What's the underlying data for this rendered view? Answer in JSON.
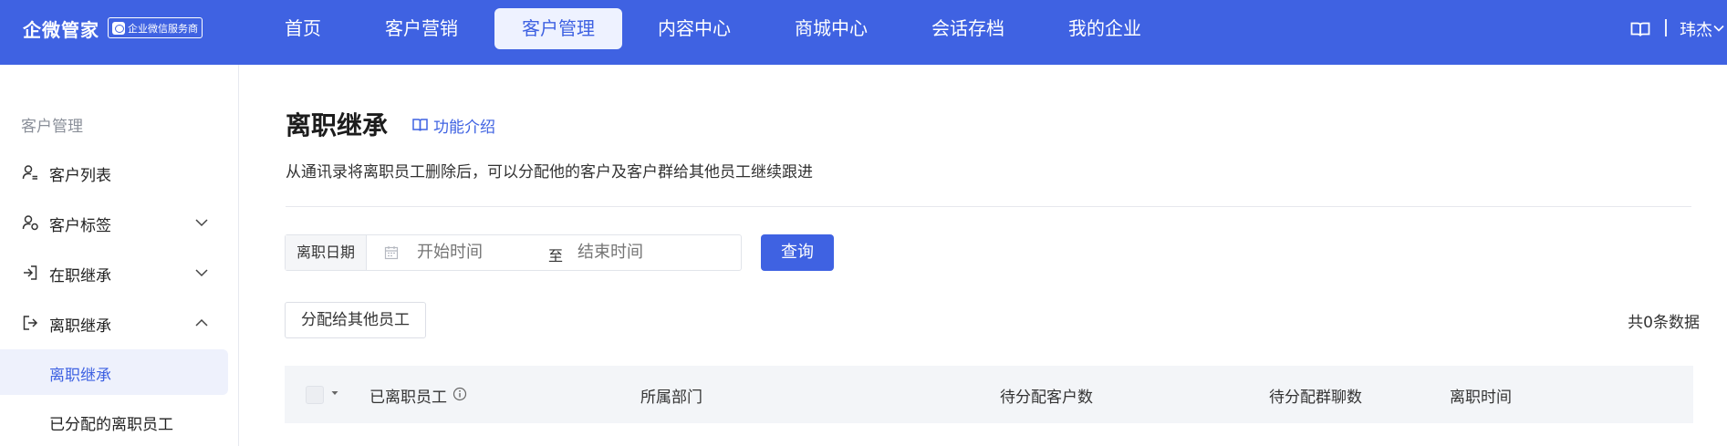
{
  "brand": {
    "name": "企微管家",
    "badge": "企业微信服务商"
  },
  "colors": {
    "primary": "#3f62e2",
    "topbar": "#3f62e2",
    "active_nav_bg": "#eef2ff",
    "sidebar_active_bg": "#eef1fc"
  },
  "nav": {
    "items": [
      {
        "label": "首页"
      },
      {
        "label": "客户营销"
      },
      {
        "label": "客户管理"
      },
      {
        "label": "内容中心"
      },
      {
        "label": "商城中心"
      },
      {
        "label": "会话存档"
      },
      {
        "label": "我的企业"
      }
    ],
    "active": "客户管理"
  },
  "user": {
    "name": "玮杰",
    "book_icon": "book-icon",
    "chevron_icon": "chevron-down-icon"
  },
  "sidebar": {
    "title": "客户管理",
    "items": [
      {
        "label": "客户列表",
        "icon": "user-list-icon"
      },
      {
        "label": "客户标签",
        "icon": "user-tag-icon"
      },
      {
        "label": "在职继承",
        "icon": "login-icon"
      },
      {
        "label": "离职继承",
        "icon": "logout-icon"
      }
    ],
    "sub_items": [
      {
        "label": "离职继承"
      },
      {
        "label": "已分配的离职员工"
      }
    ]
  },
  "page": {
    "title": "离职继承",
    "intro_link": "功能介绍",
    "description": "从通讯录将离职员工删除后，可以分配他的客户及客户群给其他员工继续跟进"
  },
  "filter": {
    "date_label": "离职日期",
    "start_placeholder": "开始时间",
    "to_text": "至",
    "end_placeholder": "结束时间",
    "query_button": "查询"
  },
  "actions": {
    "assign_button": "分配给其他员工",
    "total": "共0条数据"
  },
  "table": {
    "columns": [
      {
        "label": "已离职员工"
      },
      {
        "label": "所属部门"
      },
      {
        "label": "待分配客户数"
      },
      {
        "label": "待分配群聊数"
      },
      {
        "label": "离职时间"
      }
    ]
  }
}
